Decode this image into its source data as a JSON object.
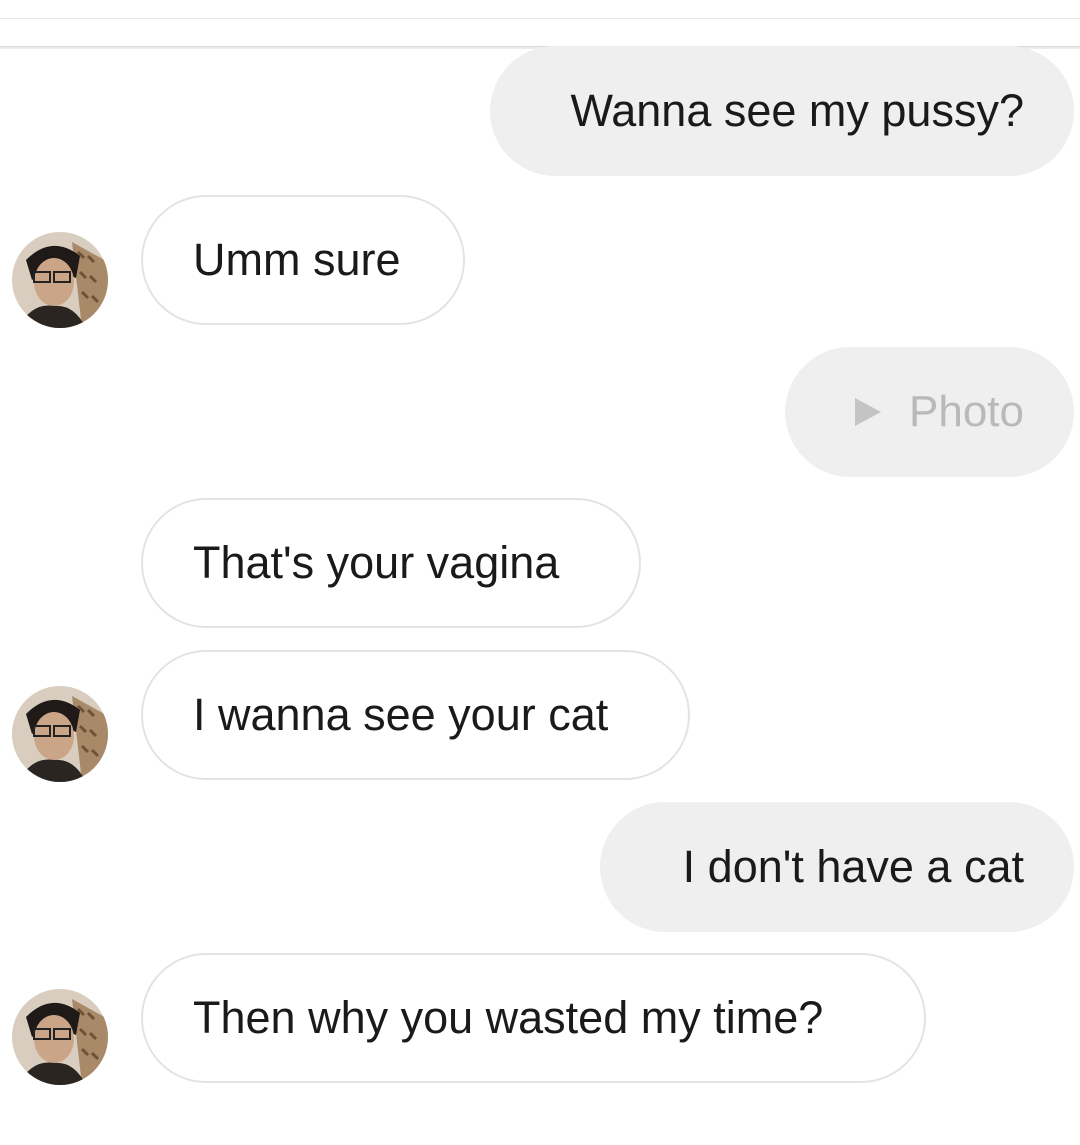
{
  "messages": [
    {
      "id": "m1",
      "direction": "outgoing",
      "text": "Wanna see my pussy?"
    },
    {
      "id": "m2",
      "direction": "incoming",
      "text": "Umm sure",
      "avatar": "user-avatar"
    },
    {
      "id": "m3",
      "direction": "outgoing",
      "text": "Photo",
      "icon": "play-icon"
    },
    {
      "id": "m4",
      "direction": "incoming",
      "text": "That's your vagina"
    },
    {
      "id": "m5",
      "direction": "incoming",
      "text": "I wanna see your cat",
      "avatar": "user-avatar"
    },
    {
      "id": "m6",
      "direction": "outgoing",
      "text": "I don't have a cat"
    },
    {
      "id": "m7",
      "direction": "incoming",
      "text": "Then why you wasted my time?",
      "avatar": "user-avatar"
    }
  ],
  "colors": {
    "outgoing_bubble": "#efefef",
    "incoming_border": "#e3e3e3",
    "photo_text": "#b9b9b9"
  }
}
